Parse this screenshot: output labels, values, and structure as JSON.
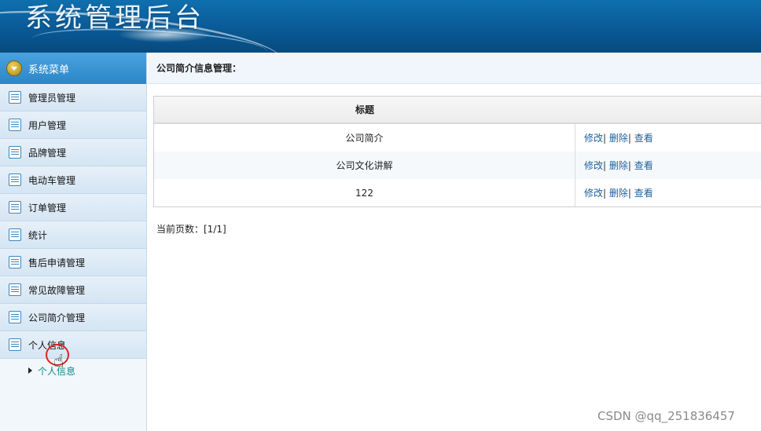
{
  "header": {
    "title": "系统管理后台"
  },
  "sidebar": {
    "head_label": "系统菜单",
    "items": [
      {
        "label": "管理员管理"
      },
      {
        "label": "用户管理"
      },
      {
        "label": "品牌管理"
      },
      {
        "label": "电动车管理"
      },
      {
        "label": "订单管理"
      },
      {
        "label": "统计"
      },
      {
        "label": "售后申请管理"
      },
      {
        "label": "常见故障管理"
      },
      {
        "label": "公司简介管理"
      },
      {
        "label": "个人信息"
      }
    ],
    "submenu": {
      "label": "个人信息"
    }
  },
  "main": {
    "breadcrumb": "公司简介信息管理：",
    "table": {
      "header": "标题",
      "rows": [
        {
          "title": "公司简介",
          "edit": "修改",
          "delete": "删除",
          "view": "查看"
        },
        {
          "title": "公司文化讲解",
          "edit": "修改",
          "delete": "删除",
          "view": "查看"
        },
        {
          "title": "122",
          "edit": "修改",
          "delete": "删除",
          "view": "查看"
        }
      ]
    },
    "pager": "当前页数：[1/1]"
  },
  "watermark": "CSDN @qq_251836457"
}
